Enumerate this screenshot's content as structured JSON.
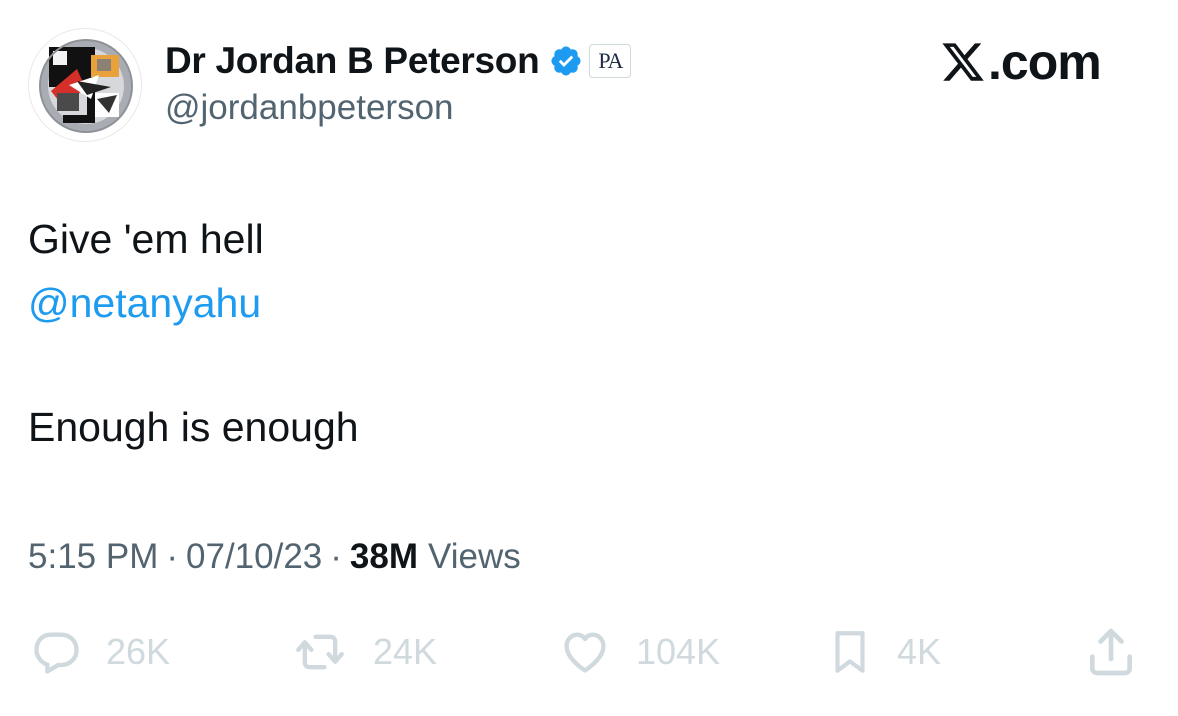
{
  "author": {
    "display_name": "Dr Jordan B Peterson",
    "handle": "@jordanbpeterson",
    "verified": true,
    "affiliate_badge_text": "PA",
    "avatar_icon": "abstract-avatar-icon"
  },
  "brand": {
    "text": ".com",
    "logo_icon": "x-logo-icon"
  },
  "tweet": {
    "lines": [
      "Give 'em hell",
      "@netanyahu",
      "Enough is enough"
    ]
  },
  "meta": {
    "time": "5:15 PM",
    "separator": "·",
    "date": "07/10/23",
    "views_count": "38M",
    "views_label": "Views"
  },
  "actions": {
    "replies": "26K",
    "retweets": "24K",
    "likes": "104K",
    "bookmarks": "4K"
  },
  "colors": {
    "text": "#0f1419",
    "secondary": "#536471",
    "link": "#1d9bf0",
    "verified": "#1d9bf0",
    "action_muted": "#cfd9de"
  }
}
